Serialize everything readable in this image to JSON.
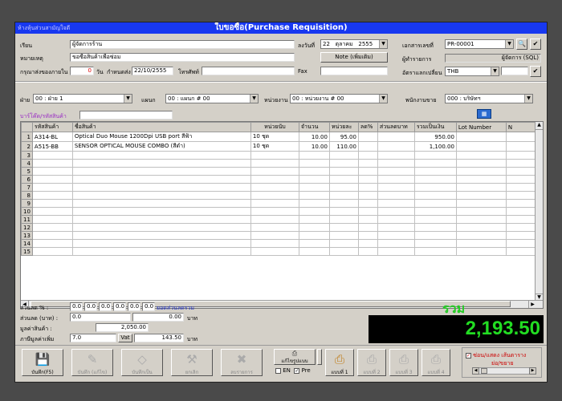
{
  "window": {
    "app_label": "ห้างหุ้นส่วนสามัญใจดี",
    "title": "ใบขอซื้อ(Purchase Requisition)"
  },
  "header": {
    "supplier_label": "เรียน",
    "supplier_value": "ผู้จัดการร้าน",
    "note_label": "หมายเหตุ",
    "note_value": "ขอซื้อสินค้าเพื่อซ่อม",
    "delivery_label": "กรุณาส่งของภายใน",
    "delivery_days": "0",
    "days_unit": "วัน",
    "due_label": "กำหนดส่ง",
    "due_date": "22/10/2555",
    "phone_label": "โทรศัพท์",
    "phone_value": "",
    "date_label": "ลงวันที่",
    "date_day": "22",
    "date_month": "ตุลาคม",
    "date_year": "2555",
    "note_button": "Note (เพิ่มเติม)",
    "fax_label": "Fax",
    "fax_value": "",
    "doc_no_label": "เอกสารเลขที่",
    "doc_no_value": "PR-00001",
    "requester_label": "ผู้ทำรายการ",
    "requester_value": "ผู้จัดการ (SQL)",
    "currency_label": "อัตราแลกเปลี่ยน",
    "currency_value": "THB",
    "currency_rate": ""
  },
  "filters": {
    "dept_label": "ฝ่าย",
    "dept_value": "00 : ฝ่าย 1",
    "section_label": "แผนก",
    "section_value": "00 : แผนก # 00",
    "unit_label": "หน่วยงาน",
    "unit_value": "00 : หน่วยงาน # 00",
    "staff_label": "พนักงานขาย",
    "staff_value": "000 : บริษัทฯ",
    "barcode_label": "บาร์โค๊ด/รหัสสินค้า",
    "barcode_value": ""
  },
  "grid": {
    "columns": [
      "รหัสสินค้า",
      "ชื่อสินค้า",
      "หน่วยนับ",
      "จำนวน",
      "หน่วยละ",
      "ลด%",
      "ส่วนลดบาท",
      "รวมเป็นเงิน",
      "Lot Number",
      "N"
    ],
    "rows": [
      {
        "n": "1",
        "code": "A314-BL",
        "name": "Optical Duo Mouse 1200Dpi USB port สีฟ้า",
        "unit": "10 ชุด",
        "qty": "10.00",
        "price": "95.00",
        "disc_pct": "",
        "disc_amt": "",
        "total": "950.00",
        "lot": ""
      },
      {
        "n": "2",
        "code": "A515-BB",
        "name": "SENSOR OPTICAL MOUSE COMBO (สีดำ)",
        "unit": "10 ชุด",
        "qty": "10.00",
        "price": "110.00",
        "disc_pct": "",
        "disc_amt": "",
        "total": "1,100.00",
        "lot": ""
      },
      {
        "n": "3"
      },
      {
        "n": "4"
      },
      {
        "n": "5"
      },
      {
        "n": "6"
      },
      {
        "n": "7"
      },
      {
        "n": "8"
      },
      {
        "n": "9"
      },
      {
        "n": "10"
      },
      {
        "n": "11"
      },
      {
        "n": "12"
      },
      {
        "n": "13"
      },
      {
        "n": "14"
      },
      {
        "n": "15"
      }
    ]
  },
  "summary": {
    "discount_pct_label": "ส่วนลด % :",
    "discount_pct_values": [
      "0.0",
      "0.0",
      "0.0",
      "0.0",
      "0.0",
      "0.0"
    ],
    "discount_total_label": "ยอดส่วนลดรวม",
    "discount_baht_label": "ส่วนลด (บาท) :",
    "discount_baht_value": "0.0",
    "discount_baht_total": "0.00",
    "baht_unit": "บาท",
    "goods_value_label": "มูลค่าสินค้า :",
    "goods_value": "2,050.00",
    "vat_label": "ภาษีมูลค่าเพิ่ม",
    "vat_rate": "7.0",
    "vat_button": "Vat",
    "vat_amount": "143.50",
    "total_label": "รวม",
    "total_value": "2,193.50"
  },
  "toolbar": {
    "save": "บันทึก(F5)",
    "save_edit": "บันทึก (แก้ไข)",
    "save_draft": "บันทึกเป็น",
    "cancel": "ยกเลิก",
    "delete": "ลบรายการ",
    "print_form": "แก้ไขรูปแบบ",
    "en": "EN",
    "pre": "Pre",
    "form1": "แบบที่ 1",
    "form2": "แบบที่ 2",
    "form3": "แบบที่ 3",
    "form4": "แบบที่ 4",
    "hide_grid": "ซ่อน/แสดง เส้นตาราง",
    "row_height": "ย่อ/ขยาย"
  },
  "colors": {
    "title_bar": "#1838f0",
    "total_bg": "#000000",
    "total_fg": "#22dd22"
  }
}
